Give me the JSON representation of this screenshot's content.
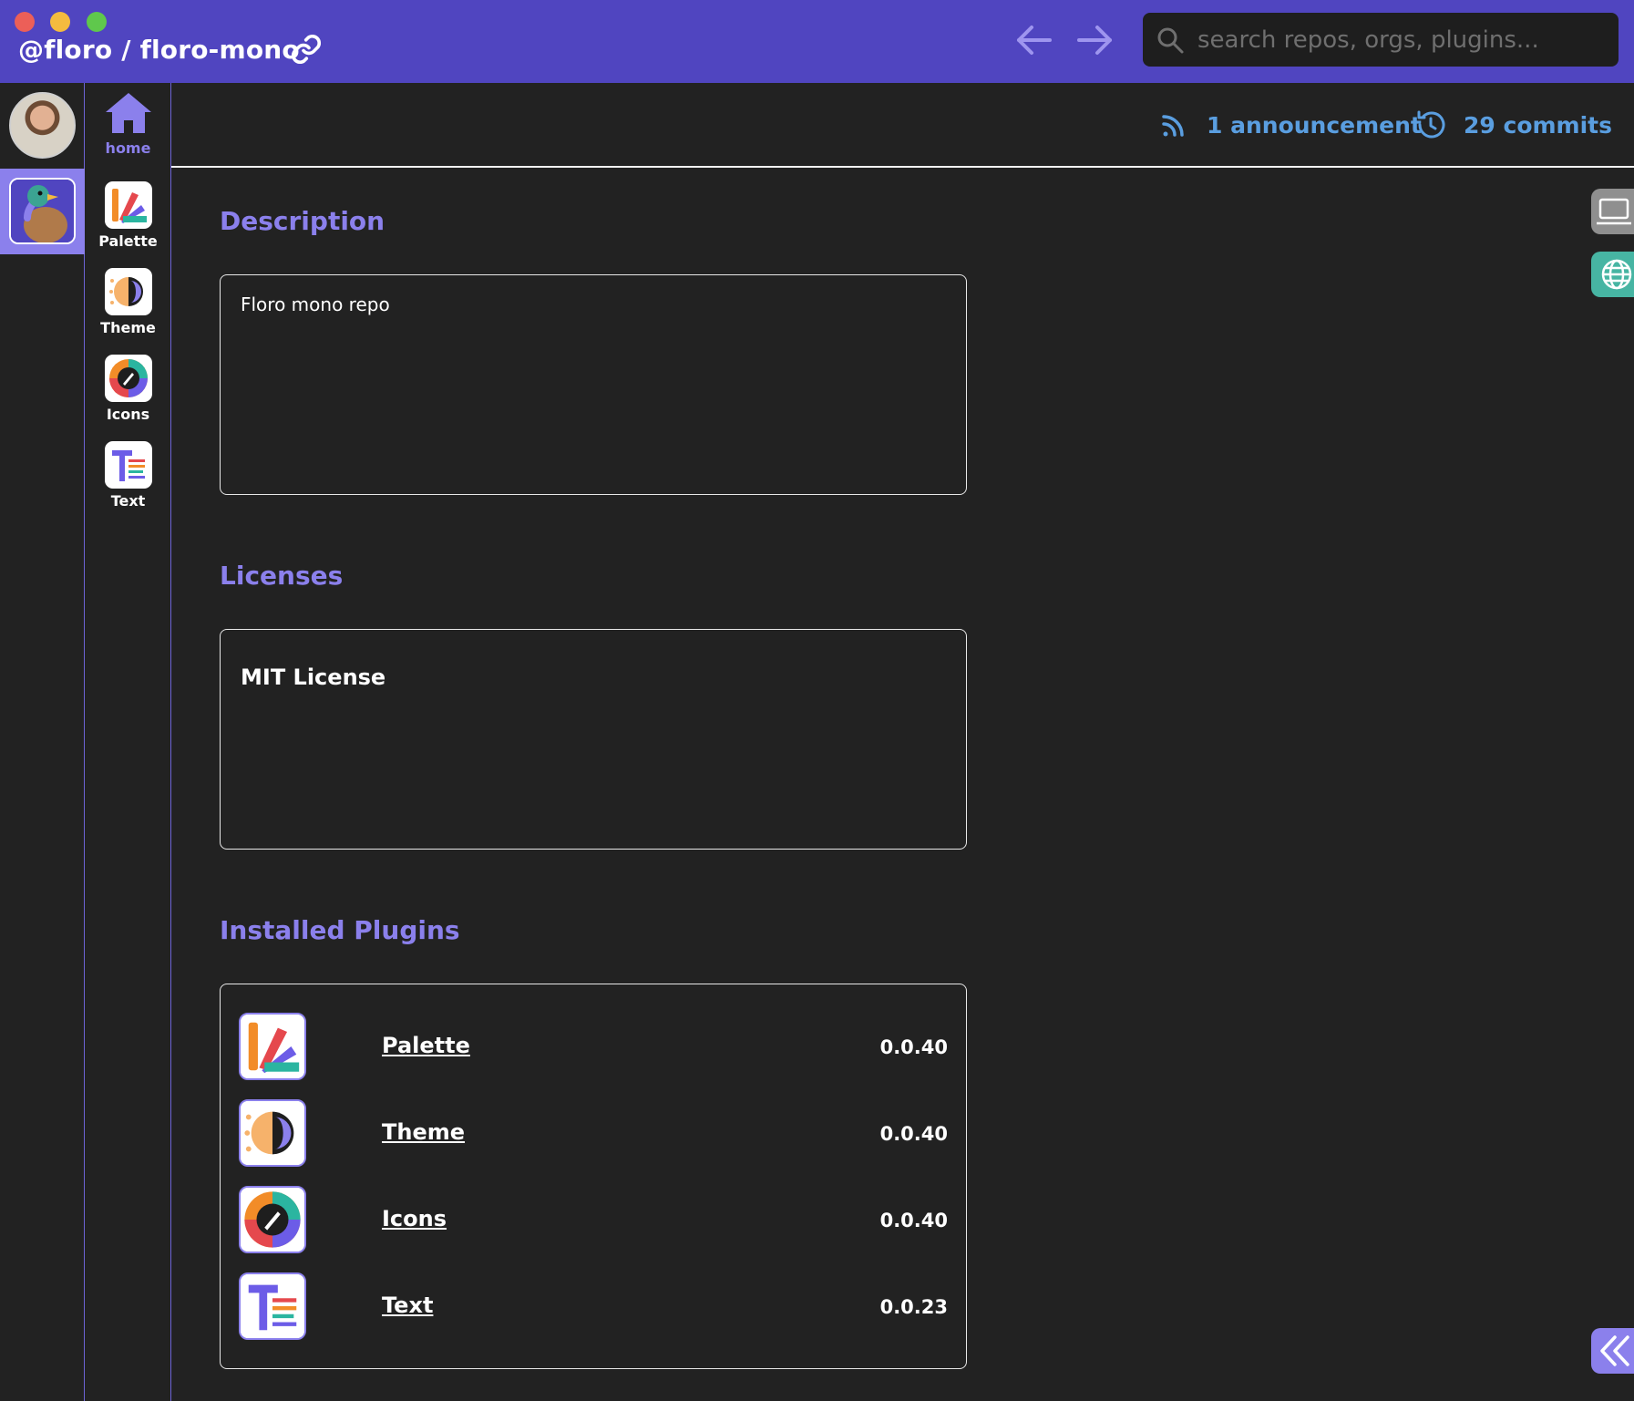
{
  "titlebar": {
    "repo_title": "@floro / floro-mono",
    "search_placeholder": "search repos, orgs, plugins..."
  },
  "sidebar": {
    "home_label": "home",
    "plugins": [
      {
        "label": "Palette",
        "icon": "palette-plugin-icon"
      },
      {
        "label": "Theme",
        "icon": "theme-plugin-icon"
      },
      {
        "label": "Icons",
        "icon": "icons-plugin-icon"
      },
      {
        "label": "Text",
        "icon": "text-plugin-icon"
      }
    ]
  },
  "header": {
    "announcements": "1 announcement",
    "commits": "29 commits"
  },
  "sections": {
    "description": {
      "title": "Description",
      "text": "Floro mono repo"
    },
    "licenses": {
      "title": "Licenses",
      "text": "MIT License"
    },
    "plugins": {
      "title": "Installed Plugins",
      "items": [
        {
          "name": "Palette",
          "version": "0.0.40"
        },
        {
          "name": "Theme",
          "version": "0.0.40"
        },
        {
          "name": "Icons",
          "version": "0.0.40"
        },
        {
          "name": "Text",
          "version": "0.0.23"
        }
      ]
    }
  },
  "colors": {
    "titlebar": "#5045c0",
    "accent": "#8b80ec",
    "link": "#5a9ee0",
    "background": "#222222"
  }
}
